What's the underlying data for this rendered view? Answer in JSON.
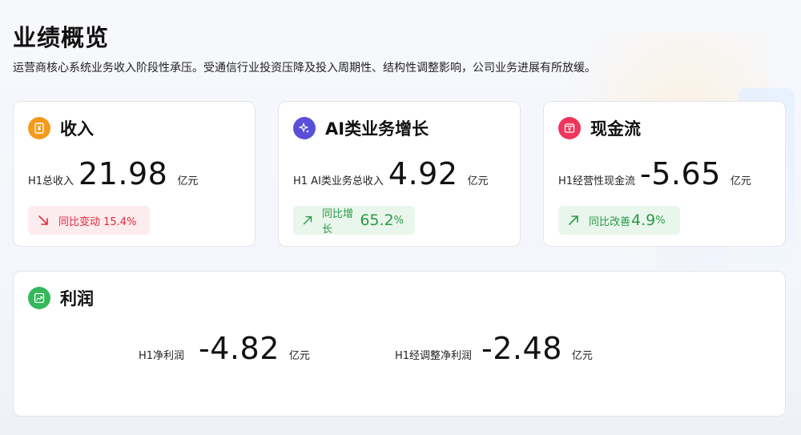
{
  "page": {
    "title": "业绩概览",
    "subtitle": "运营商核心系统业务收入阶段性承压。受通信行业投资压降及投入周期性、结构性调整影响，公司业务进展有所放缓。"
  },
  "colors": {
    "revenue_icon": "#f59a1b",
    "ai_icon": "#5b4fd8",
    "cashflow_icon": "#f0365e",
    "profit_icon": "#34b85a",
    "down": "#e02a3c",
    "up": "#2a9a47"
  },
  "cards": {
    "revenue": {
      "icon": "yuan-document-icon",
      "title": "收入",
      "label": "H1总收入",
      "value": "21.98",
      "unit": "亿元",
      "badge_text": "同比变动 15.4%",
      "badge_trend": "down"
    },
    "ai": {
      "icon": "sparkle-icon",
      "title": "AI类业务增长",
      "label": "H1 AI类业务总收入",
      "value": "4.92",
      "unit": "亿元",
      "badge_prefix": "同比增长",
      "badge_num": "65.2",
      "badge_pct": "%",
      "badge_trend": "up"
    },
    "cashflow": {
      "icon": "cash-box-icon",
      "title": "现金流",
      "label": "H1经营性现金流",
      "value": "-5.65",
      "unit": "亿元",
      "badge_prefix": "同比改善",
      "badge_num": "4.9",
      "badge_pct": "%",
      "badge_trend": "up"
    },
    "profit": {
      "icon": "profit-chart-icon",
      "title": "利润",
      "net_label": "H1净利润",
      "net_value": "-4.82",
      "net_unit": "亿元",
      "adj_label": "H1经调整净利润",
      "adj_value": "-2.48",
      "adj_unit": "亿元"
    }
  }
}
